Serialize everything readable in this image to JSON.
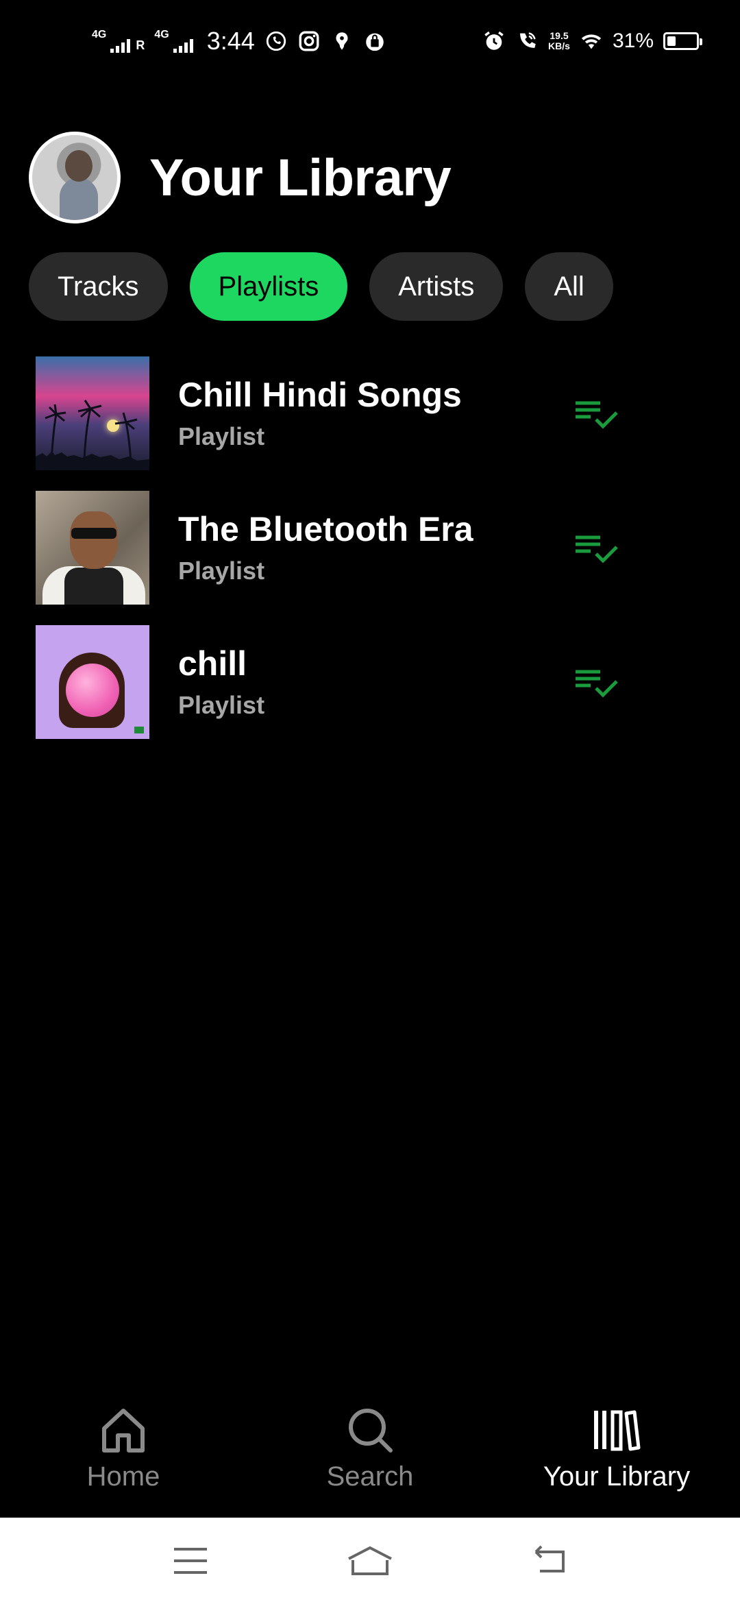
{
  "status_bar": {
    "network1": "4G",
    "roaming": "R",
    "network2": "4G",
    "time": "3:44",
    "speed_value": "19.5",
    "speed_unit": "KB/s",
    "battery_percent": "31%",
    "battery_level": 0.31,
    "icons": [
      "whatsapp-icon",
      "instagram-icon",
      "app-icon",
      "shopping-bag-icon",
      "alarm-icon",
      "wifi-call-icon",
      "wifi-icon",
      "battery-icon"
    ]
  },
  "header": {
    "title": "Your Library"
  },
  "filters": [
    {
      "label": "Tracks",
      "active": false
    },
    {
      "label": "Playlists",
      "active": true
    },
    {
      "label": "Artists",
      "active": false
    },
    {
      "label": "All",
      "active": false
    }
  ],
  "playlists": [
    {
      "title": "Chill Hindi Songs",
      "subtitle": "Playlist",
      "icon": "added-to-library-icon"
    },
    {
      "title": "The Bluetooth Era",
      "subtitle": "Playlist",
      "icon": "added-to-library-icon"
    },
    {
      "title": "chill",
      "subtitle": "Playlist",
      "icon": "added-to-library-icon"
    }
  ],
  "bottom_nav": [
    {
      "label": "Home",
      "icon": "home-icon",
      "active": false
    },
    {
      "label": "Search",
      "icon": "search-icon",
      "active": false
    },
    {
      "label": "Your Library",
      "icon": "library-icon",
      "active": true
    }
  ],
  "system_nav": [
    "menu-icon",
    "home-icon",
    "back-icon"
  ],
  "colors": {
    "accent": "#1ed760",
    "icon_green": "#1a9c3e",
    "chip_bg": "#2a2a2a",
    "background": "#000000",
    "muted_text": "#a7a7a7"
  }
}
